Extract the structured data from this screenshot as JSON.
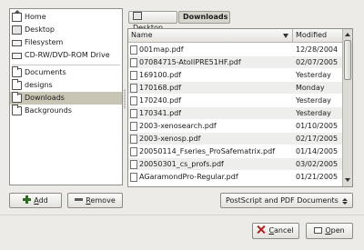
{
  "places": {
    "items": [
      {
        "label": "Home",
        "icon": "home-icon"
      },
      {
        "label": "Desktop",
        "icon": "desktop-icon"
      },
      {
        "label": "Filesystem",
        "icon": "drive-icon"
      },
      {
        "label": "CD-RW/DVD-ROM Drive",
        "icon": "cdrom-icon"
      },
      {
        "label": "Documents",
        "icon": "folder-icon"
      },
      {
        "label": "designs",
        "icon": "folder-icon"
      },
      {
        "label": "Downloads",
        "icon": "folder-icon",
        "selected": true
      },
      {
        "label": "Backgrounds",
        "icon": "folder-icon"
      }
    ],
    "add_prefix": "A",
    "add_rest": "dd",
    "remove_prefix": "R",
    "remove_rest": "emove"
  },
  "path": {
    "items": [
      {
        "label": "Desktop",
        "icon": "desktop-icon"
      },
      {
        "label": "Downloads",
        "active": true
      }
    ]
  },
  "file_list": {
    "columns": [
      "Name",
      "Modified"
    ],
    "rows": [
      {
        "name": "001map.pdf",
        "modified": "12/28/2004"
      },
      {
        "name": "07084715-AtollPRE51HF.pdf",
        "modified": "02/07/2005"
      },
      {
        "name": "169100.pdf",
        "modified": "Yesterday"
      },
      {
        "name": "170168.pdf",
        "modified": "Monday"
      },
      {
        "name": "170240.pdf",
        "modified": "Yesterday"
      },
      {
        "name": "170341.pdf",
        "modified": "Yesterday"
      },
      {
        "name": "2003-xenosearch.pdf",
        "modified": "01/10/2005"
      },
      {
        "name": "2003-xenosp.pdf",
        "modified": "02/17/2005"
      },
      {
        "name": "20050114_Fseries_ProSafematrix.pdf",
        "modified": "01/14/2005"
      },
      {
        "name": "20050301_cs_profs.pdf",
        "modified": "03/02/2005"
      },
      {
        "name": "AGaramondPro-Regular.pdf",
        "modified": "01/21/2005"
      }
    ]
  },
  "filter": {
    "selected": "PostScript and PDF Documents"
  },
  "actions": {
    "cancel_prefix": "C",
    "cancel_rest": "ancel",
    "open_prefix": "O",
    "open_rest": "pen"
  }
}
